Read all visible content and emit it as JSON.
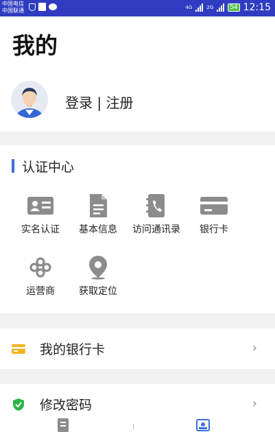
{
  "status_bar": {
    "carrier_1": "中国电信",
    "carrier_2": "中国联通",
    "signal_1": "4G",
    "signal_2": "2G",
    "battery": "54",
    "time": "12:15"
  },
  "page": {
    "title": "我的"
  },
  "profile": {
    "login_label": "登录 | 注册"
  },
  "certification": {
    "title": "认证中心",
    "accent_color": "#3b6fe0",
    "items": [
      {
        "label": "实名认证",
        "icon": "id-card-icon"
      },
      {
        "label": "基本信息",
        "icon": "document-icon"
      },
      {
        "label": "访问通讯录",
        "icon": "contacts-book-icon"
      },
      {
        "label": "银行卡",
        "icon": "bank-card-icon"
      },
      {
        "label": "运营商",
        "icon": "carrier-knot-icon"
      },
      {
        "label": "获取定位",
        "icon": "location-pin-icon"
      }
    ]
  },
  "menu": [
    {
      "label": "我的银行卡",
      "icon": "wallet-card-icon",
      "icon_color": "#f5b41e"
    },
    {
      "label": "修改密码",
      "icon": "shield-check-icon",
      "icon_color": "#2bb54a"
    }
  ],
  "tab_bar": {
    "items": [
      {
        "icon": "list-doc-icon"
      },
      {
        "icon": "profile-card-icon",
        "active_color": "#3b6fe0"
      }
    ]
  }
}
